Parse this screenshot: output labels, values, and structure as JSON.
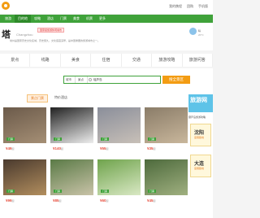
{
  "topbar": {
    "links": [
      "我的携程",
      "团购",
      "手机版"
    ]
  },
  "nav": {
    "items": [
      "旅游",
      "目的地",
      "攻略",
      "酒店",
      "门票",
      "美食",
      "机票",
      "更多"
    ],
    "active_index": 1
  },
  "header": {
    "city": "塔",
    "subtitle": "Changzhou",
    "badge": "国家级旅游休闲城市",
    "description": "常州是国家历史文化名城，历史悠久，文化底蕴深厚，是中国重要的旅游城市之一。",
    "weather_temp": "晴",
    "weather_sub": "20°C"
  },
  "tabs": [
    "景点",
    "线路",
    "美食",
    "住宿",
    "交通",
    "旅游攻略",
    "旅游问答"
  ],
  "search": {
    "city_select": "城市",
    "type_select": "景点",
    "value": "瑶芦岛",
    "button_label": "搜全景区"
  },
  "subtabs": {
    "items": [
      "景点门票",
      "特价酒店"
    ],
    "active_index": 0
  },
  "cards": [
    {
      "price": "49",
      "tag": "门票",
      "colors": [
        "#6b5a4a",
        "#a58f75"
      ]
    },
    {
      "price": "140",
      "tag": "门票",
      "colors": [
        "#222222",
        "#eeeeee"
      ]
    },
    {
      "price": "55",
      "tag": "门票",
      "colors": [
        "#8a8e9a",
        "#c8c0b8"
      ]
    },
    {
      "price": "35",
      "tag": "门票",
      "colors": [
        "#8a7c68",
        "#c9b79c"
      ]
    },
    {
      "price": "99",
      "tag": "门票",
      "colors": [
        "#4a3a2e",
        "#b28e5e"
      ]
    },
    {
      "price": "85",
      "tag": "门票",
      "colors": [
        "#5a7a46",
        "#c9c3a8"
      ]
    },
    {
      "price": "60",
      "tag": "门票",
      "colors": [
        "#6fa34c",
        "#d9e8c4"
      ]
    },
    {
      "price": "45",
      "tag": "门票",
      "colors": [
        "#4d6a3c",
        "#a0b080"
      ]
    }
  ],
  "sidebar": {
    "banner": "旅游网",
    "title": "葫芦岛旅游攻略",
    "cards": [
      "沈阳",
      "大连"
    ],
    "card_sub": "度假胜地"
  },
  "accent_color": "#3fa23a",
  "button_color": "#f39c12"
}
